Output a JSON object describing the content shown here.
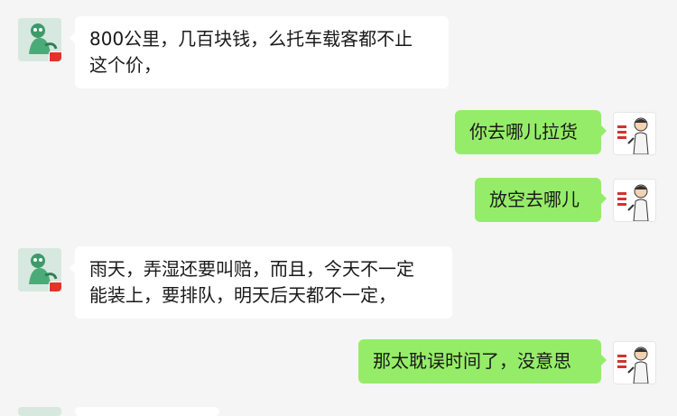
{
  "messages": [
    {
      "side": "in",
      "lines": [
        "800公里，几百块钱，么托车载客都不止",
        "这个价，"
      ]
    },
    {
      "side": "out",
      "text": "你去哪儿拉货"
    },
    {
      "side": "out",
      "text": "放空去哪儿"
    },
    {
      "side": "in",
      "lines": [
        "雨天，弄湿还要叫赔，而且，今天不一定",
        "能装上，要排队，明天后天都不一定，"
      ]
    },
    {
      "side": "out",
      "text": "那太耽误时间了，没意思"
    }
  ],
  "colors": {
    "background": "#f5f5f5",
    "incoming_bubble": "#ffffff",
    "outgoing_bubble": "#95ec69",
    "flag_badge": "#e5332a"
  },
  "icons": {
    "contact_avatar": "cartoon-mascot-avatar",
    "self_avatar": "cartoon-man-avatar",
    "badge": "china-flag-icon"
  }
}
